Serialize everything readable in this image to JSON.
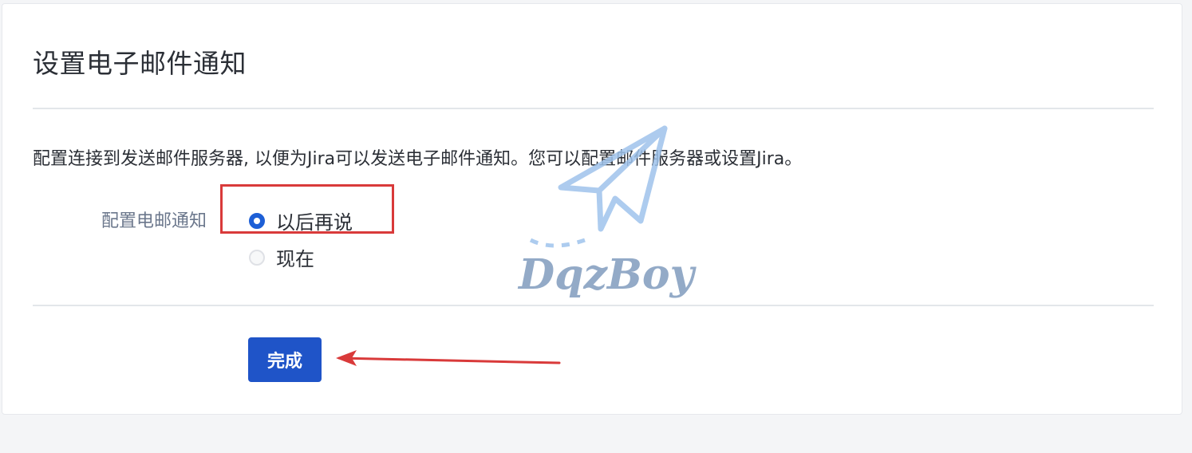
{
  "card": {
    "title": "设置电子邮件通知",
    "description": "配置连接到发送邮件服务器, 以便为Jira可以发送电子邮件通知。您可以配置邮件服务器或设置Jira。"
  },
  "form": {
    "field_label": "配置电邮通知",
    "options": [
      {
        "label": "以后再说",
        "selected": true
      },
      {
        "label": "现在",
        "selected": false
      }
    ]
  },
  "actions": {
    "done_label": "完成"
  },
  "annotations": {
    "highlight_color": "#d93a3a",
    "arrow_color": "#d93a3a"
  },
  "watermark": {
    "text": "DqzBoy",
    "icon": "paper-plane-icon"
  },
  "colors": {
    "primary": "#1f54c8",
    "background": "#f4f5f7"
  }
}
